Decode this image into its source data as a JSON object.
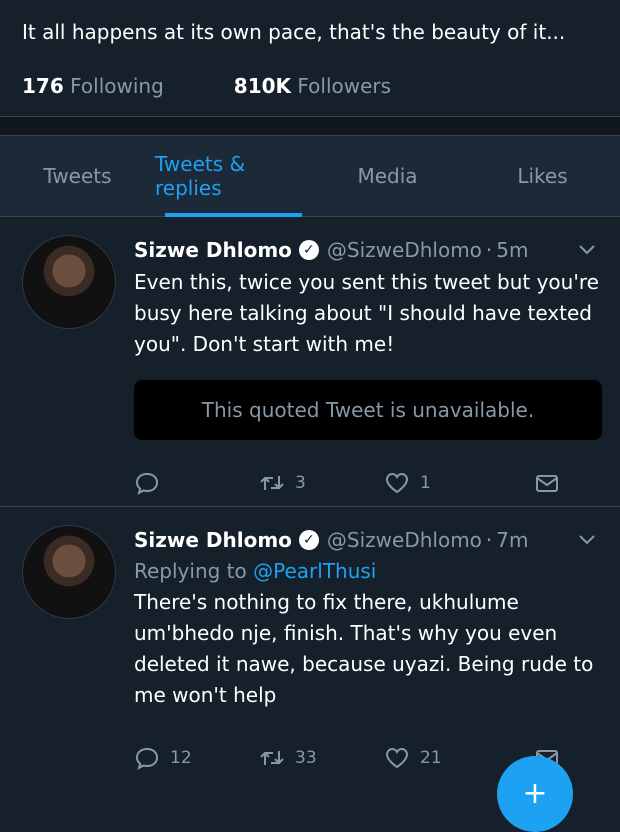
{
  "profile": {
    "bio": "It all happens at its own pace, that's the beauty of it...",
    "following_count": "176",
    "following_label": "Following",
    "followers_count": "810K",
    "followers_label": "Followers"
  },
  "tabs": [
    {
      "label": "Tweets",
      "active": false
    },
    {
      "label": "Tweets & replies",
      "active": true
    },
    {
      "label": "Media",
      "active": false
    },
    {
      "label": "Likes",
      "active": false
    }
  ],
  "tweets": [
    {
      "name": "Sizwe Dhlomo",
      "handle": "@SizweDhlomo",
      "time": "5m",
      "text": "Even this, twice you sent this tweet but you're busy here talking about \"I should have texted you\". Don't start with me!",
      "quote": "This quoted Tweet is unavailable.",
      "replies": "",
      "retweets": "3",
      "likes": "1"
    },
    {
      "name": "Sizwe Dhlomo",
      "handle": "@SizweDhlomo",
      "time": "7m",
      "replying_label": "Replying to",
      "replying_to": "@PearlThusi",
      "text": "There's nothing to fix there, ukhulume um'bhedo nje, finish. That's why you even deleted it nawe, because uyazi. Being rude to me won't help",
      "replies": "12",
      "retweets": "33",
      "likes": "21"
    }
  ],
  "fab": {
    "icon": "compose-icon"
  },
  "colors": {
    "background": "#15202b",
    "accent": "#1da1f2",
    "muted": "#8899a6"
  }
}
